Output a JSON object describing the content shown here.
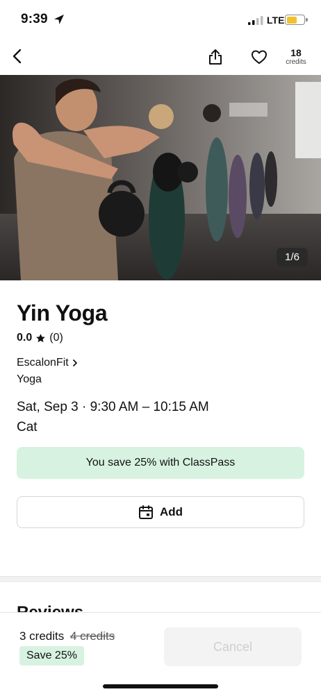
{
  "status": {
    "time": "9:39",
    "network": "LTE",
    "battery_color": "#f2c12e"
  },
  "nav": {
    "back_icon": "chevron-left-icon",
    "share_icon": "share-icon",
    "favorite_icon": "heart-icon",
    "credits_count": "18",
    "credits_label": "credits"
  },
  "hero": {
    "pager": "1/6"
  },
  "class": {
    "title": "Yin Yoga",
    "rating_score": "0.0",
    "rating_count": "(0)",
    "studio": "EscalonFit",
    "category": "Yoga",
    "datetime": "Sat, Sep 3 · 9:30 AM – 10:15 AM",
    "instructor": "Cat"
  },
  "savings_banner": "You save 25% with ClassPass",
  "add_button": "Add",
  "reviews_heading": "Reviews",
  "bottom": {
    "credits_now": "3 credits",
    "credits_was": "4 credits",
    "save_badge": "Save 25%",
    "cancel_button": "Cancel"
  },
  "colors": {
    "accent_green_bg": "#d8f2e1"
  }
}
